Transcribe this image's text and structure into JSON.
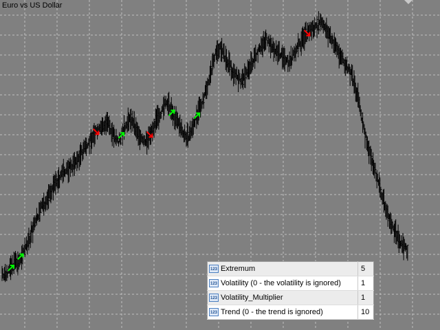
{
  "window": {
    "title": "Euro vs US Dollar"
  },
  "colors": {
    "background": "#808080",
    "grid": "#c0c0c0",
    "bars": "#000000",
    "buy_arrow": "#00ff00",
    "sell_arrow": "#ff0000"
  },
  "parameters": {
    "rows": [
      {
        "icon": "integer-type-icon",
        "name": "Extremum",
        "value": "5"
      },
      {
        "icon": "integer-type-icon",
        "name": "Volatility (0 - the volatility is ignored)",
        "value": "1"
      },
      {
        "icon": "integer-type-icon",
        "name": "Volatility_Multiplier",
        "value": "1"
      },
      {
        "icon": "integer-type-icon",
        "name": "Trend (0 - the trend is ignored)",
        "value": "10"
      }
    ]
  },
  "chart_data": {
    "type": "ohlc-bars",
    "y_range": [
      0,
      100
    ],
    "series": [
      {
        "values": [
          8,
          7,
          9,
          10,
          12,
          11,
          14,
          16,
          18,
          21,
          24,
          27,
          30,
          32,
          34,
          36,
          38,
          40,
          41,
          43,
          44,
          45,
          46,
          47,
          48,
          50,
          52,
          53,
          55,
          57,
          58,
          59,
          60,
          61,
          60,
          58,
          56,
          55,
          57,
          59,
          62,
          63,
          60,
          58,
          56,
          54,
          55,
          57,
          60,
          62,
          64,
          66,
          68,
          67,
          65,
          63,
          61,
          59,
          57,
          56,
          58,
          61,
          64,
          67,
          70,
          74,
          78,
          83,
          87,
          88,
          86,
          84,
          82,
          80,
          79,
          77,
          76,
          78,
          80,
          82,
          84,
          86,
          88,
          90,
          91,
          89,
          88,
          87,
          86,
          85,
          84,
          83,
          84,
          86,
          88,
          90,
          92,
          93,
          94,
          95,
          96,
          97,
          96,
          94,
          92,
          90,
          88,
          86,
          84,
          82,
          80,
          78,
          74,
          70,
          64,
          58,
          54,
          50,
          46,
          42,
          38,
          34,
          30,
          27,
          24,
          22,
          20,
          18,
          17,
          16
        ]
      }
    ],
    "signals": [
      {
        "index": 3,
        "direction": "up"
      },
      {
        "index": 6,
        "direction": "up"
      },
      {
        "index": 30,
        "direction": "down"
      },
      {
        "index": 38,
        "direction": "up"
      },
      {
        "index": 47,
        "direction": "down"
      },
      {
        "index": 54,
        "direction": "up"
      },
      {
        "index": 62,
        "direction": "up"
      },
      {
        "index": 97,
        "direction": "down"
      }
    ]
  }
}
